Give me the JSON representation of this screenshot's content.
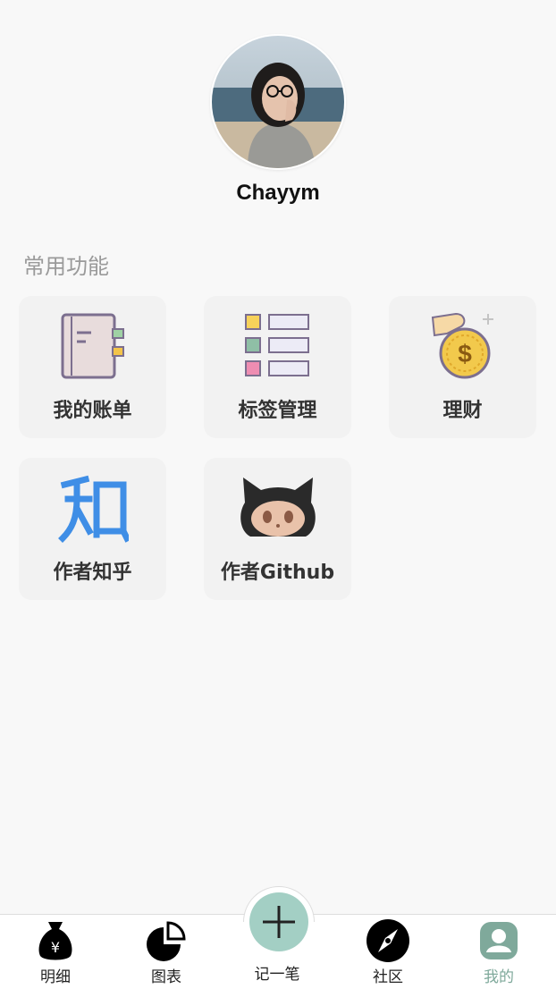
{
  "profile": {
    "username": "Chayym",
    "avatar_alt": "user avatar photo"
  },
  "section": {
    "title": "常用功能"
  },
  "features": [
    {
      "label": "我的账单",
      "icon": "notebook-icon"
    },
    {
      "label": "标签管理",
      "icon": "tag-list-icon"
    },
    {
      "label": "理财",
      "icon": "coin-hand-icon"
    },
    {
      "label": "作者知乎",
      "icon": "zhihu-icon"
    },
    {
      "label": "作者Github",
      "icon": "github-octocat-icon"
    }
  ],
  "tabbar": {
    "items": [
      {
        "label": "明细",
        "icon": "money-bag-icon"
      },
      {
        "label": "图表",
        "icon": "pie-chart-icon"
      },
      {
        "label": "记一笔",
        "icon": "plus-icon"
      },
      {
        "label": "社区",
        "icon": "compass-icon"
      },
      {
        "label": "我的",
        "icon": "user-icon",
        "active": true
      }
    ]
  },
  "colors": {
    "accent": "#a3cfc4",
    "active_tab": "#7fa99b",
    "zhihu_blue": "#3f8ee6"
  }
}
